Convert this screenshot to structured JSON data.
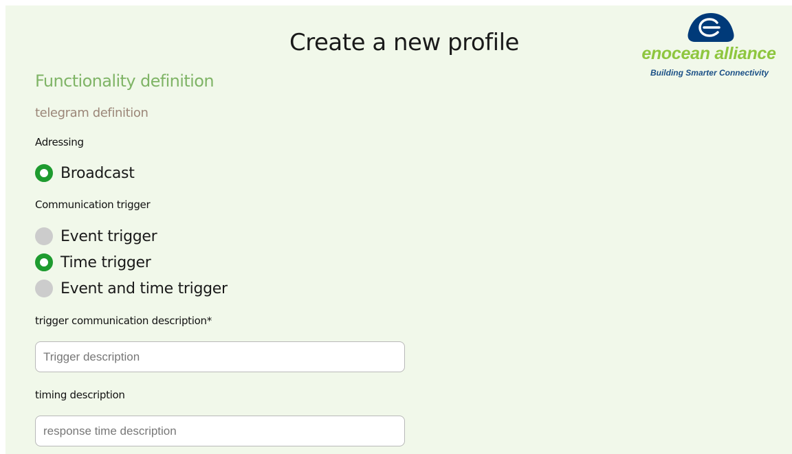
{
  "header": {
    "title": "Create a new profile"
  },
  "logo": {
    "icon": "enocean-logo-icon",
    "name": "enocean alliance",
    "tagline": "Building Smarter Connectivity",
    "colors": {
      "mark": "#003a79",
      "name": "#8ec63f",
      "tagline": "#1a4f86"
    }
  },
  "section": {
    "title": "Functionality definition",
    "subtitle": "telegram definition"
  },
  "addressing": {
    "label": "Adressing",
    "options": [
      {
        "label": "Broadcast",
        "selected": true
      }
    ]
  },
  "communication_trigger": {
    "label": "Communication trigger",
    "options": [
      {
        "label": "Event trigger",
        "selected": false
      },
      {
        "label": "Time trigger",
        "selected": true
      },
      {
        "label": "Event and time trigger",
        "selected": false
      }
    ]
  },
  "trigger_description": {
    "label": "trigger communication description*",
    "placeholder": "Trigger description",
    "value": ""
  },
  "timing_description": {
    "label": "timing description",
    "placeholder": "response time description",
    "value": ""
  },
  "colors": {
    "background": "#f1f8ea",
    "accent": "#1e9b2f",
    "section_title": "#7fb466",
    "subsection_title": "#9b8678",
    "radio_unselected": "#cccccc"
  }
}
